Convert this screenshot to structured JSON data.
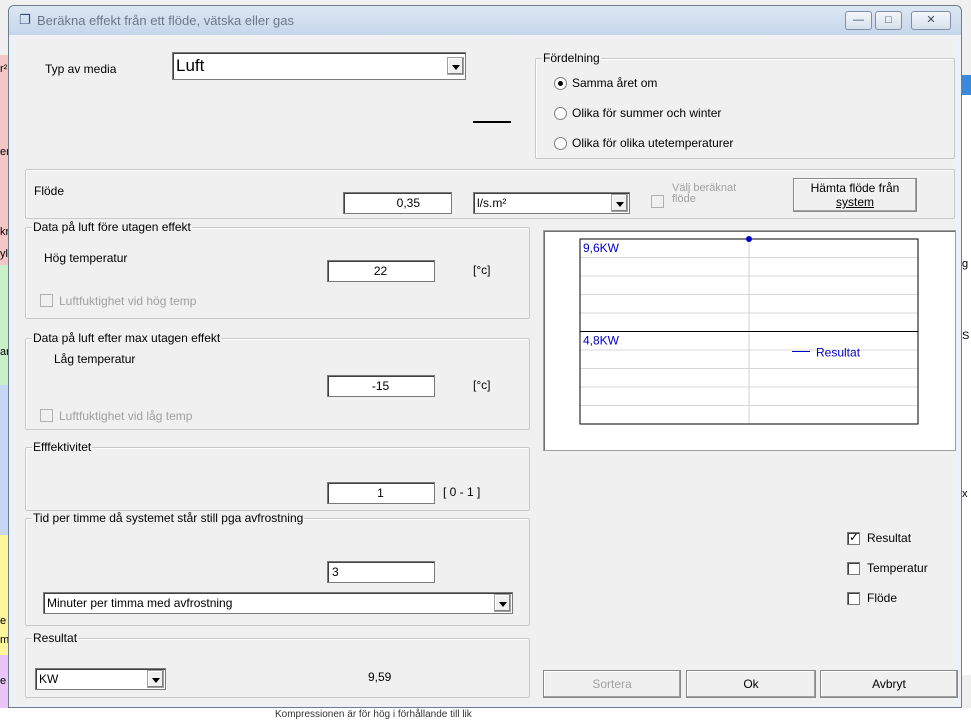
{
  "background": {
    "left_fragments": [
      "r²",
      "er",
      "kr",
      "yl",
      "ar",
      "e",
      "m",
      "e"
    ],
    "right_fragments": [
      "g",
      "S",
      "x"
    ],
    "bottom_text": "Kompressionen är för hög i förhållande till lik"
  },
  "window": {
    "title": "Beräkna effekt från ett flöde, vätska eller gas",
    "minimize": "—",
    "maximize": "□",
    "close": "✕"
  },
  "media": {
    "label": "Typ av media",
    "value": "Luft"
  },
  "distribution": {
    "title": "Fördelning",
    "options": [
      "Samma året om",
      "Olika för summer och winter",
      "Olika för olika utetemperaturer"
    ],
    "selected_index": 0
  },
  "flow": {
    "label": "Flöde",
    "value": "0,35",
    "unit": "l/s.m²",
    "calc_checkbox_label_line1": "Välj beräknat",
    "calc_checkbox_label_line2": "flöde",
    "fetch_button_line1": "Hämta flöde från",
    "fetch_button_line2": "system"
  },
  "before": {
    "title": "Data på luft före utagen effekt",
    "temp_label": "Hög temperatur",
    "temp_value": "22",
    "unit": "[°c]",
    "humidity_label": "Luftfuktighet vid hög temp"
  },
  "after": {
    "title": "Data på luft efter max utagen effekt",
    "temp_label": "Låg temperatur",
    "temp_value": "-15",
    "unit": "[°c]",
    "humidity_label": "Luftfuktighet vid låg temp"
  },
  "efficiency": {
    "title": "Efffektivitet",
    "value": "1",
    "range": "[ 0 - 1 ]"
  },
  "defrost": {
    "title": "Tid per timme då systemet står still pga avfrostning",
    "value": "3",
    "mode": "Minuter per timma med avfrostning"
  },
  "result": {
    "title": "Resultat",
    "unit": "KW",
    "value": "9,59"
  },
  "legend_checks": [
    {
      "label": "Resultat",
      "checked": true
    },
    {
      "label": "Temperatur",
      "checked": false
    },
    {
      "label": "Flöde",
      "checked": false
    }
  ],
  "buttons": {
    "sort": "Sortera",
    "ok": "Ok",
    "cancel": "Avbryt"
  },
  "chart_data": {
    "type": "line",
    "y_labels": [
      "9,6KW",
      "4,8KW"
    ],
    "ylim": [
      0,
      9.6
    ],
    "series": [
      {
        "name": "Resultat",
        "color": "#0000cc",
        "x": [
          0.5
        ],
        "values": [
          9.6
        ]
      }
    ],
    "legend": "right"
  }
}
